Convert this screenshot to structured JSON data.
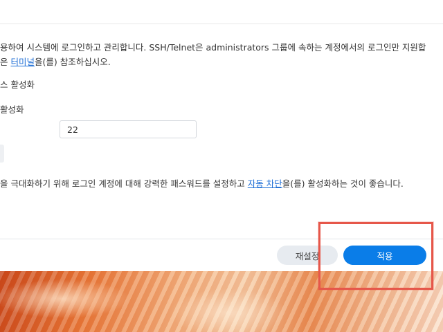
{
  "description": {
    "line1": "용하여 시스템에 로그인하고 관리합니다. SSH/Telnet은 administrators 그룹에 속하는 계정에서의 로그인만 지원합",
    "line2_prefix": "은 ",
    "line2_link": "터미널",
    "line2_suffix": "을(를) 참조하십시오."
  },
  "options": {
    "telnet_label": "스 활성화",
    "ssh_label": "활성화"
  },
  "port": {
    "value": "22"
  },
  "security_note": {
    "prefix": "을 극대화하기 위해 로그인 계정에 대해 강력한 패스워드를 설정하고 ",
    "link": "자동 차단",
    "suffix": "을(를) 활성화하는 것이 좋습니다."
  },
  "footer": {
    "reset_label": "재설정",
    "apply_label": "적용"
  },
  "colors": {
    "accent": "#0a7de8",
    "link": "#1f6fd6",
    "highlight": "#e6574a"
  }
}
